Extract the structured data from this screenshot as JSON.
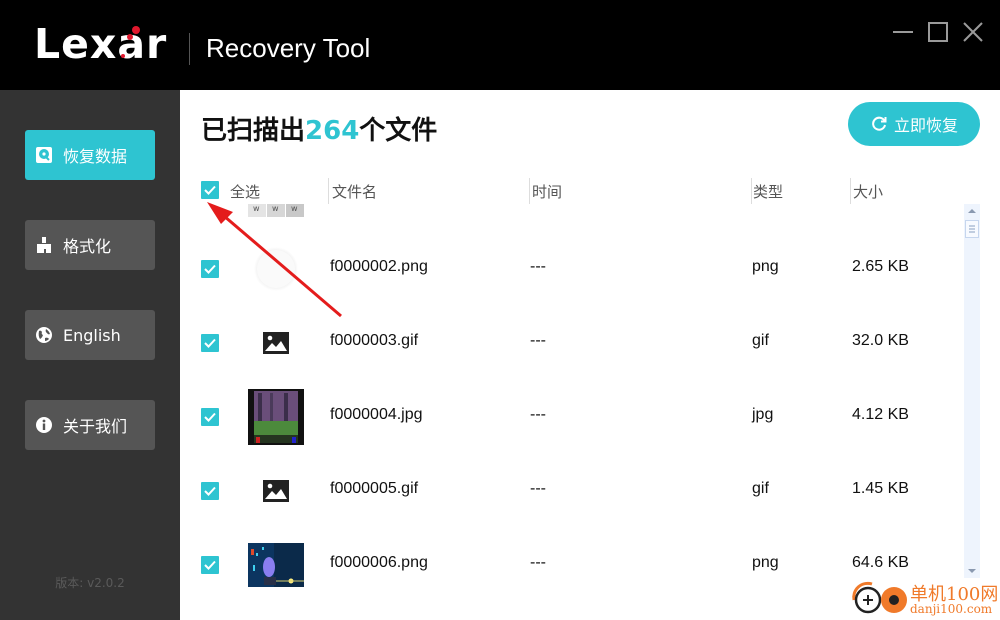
{
  "window": {
    "brand": "Lexar",
    "title": "Recovery Tool",
    "controls": [
      "minimize-icon",
      "maximize-icon",
      "close-icon"
    ]
  },
  "sidebar": {
    "items": [
      {
        "label": "恢复数据",
        "icon": "disk-recover-icon",
        "active": true
      },
      {
        "label": "格式化",
        "icon": "broom-icon",
        "active": false
      },
      {
        "label": "English",
        "icon": "globe-icon",
        "active": false
      },
      {
        "label": "关于我们",
        "icon": "info-icon",
        "active": false
      }
    ],
    "version": "版本: v2.0.2"
  },
  "main": {
    "title_prefix": "已扫描出",
    "file_count": "264",
    "title_suffix": "个文件",
    "recover_button": "立即恢复",
    "accent_color": "#2ec4d1"
  },
  "table": {
    "select_all_label": "全选",
    "select_all_checked": true,
    "columns": [
      "文件名",
      "时间",
      "类型",
      "大小"
    ],
    "rows": [
      {
        "checked": true,
        "thumb": "partial-thumbnail",
        "name": "",
        "time": "",
        "type": "",
        "size": ""
      },
      {
        "checked": true,
        "thumb": "white-circle-thumbnail",
        "name": "f0000002.png",
        "time": "---",
        "type": "png",
        "size": "2.65 KB"
      },
      {
        "checked": true,
        "thumb": "image-placeholder-icon",
        "name": "f0000003.gif",
        "time": "---",
        "type": "gif",
        "size": "32.0 KB"
      },
      {
        "checked": true,
        "thumb": "game-screenshot-thumbnail",
        "name": "f0000004.jpg",
        "time": "---",
        "type": "jpg",
        "size": "4.12 KB"
      },
      {
        "checked": true,
        "thumb": "image-placeholder-icon",
        "name": "f0000005.gif",
        "time": "---",
        "type": "gif",
        "size": "1.45 KB"
      },
      {
        "checked": true,
        "thumb": "neon-city-thumbnail",
        "name": "f0000006.png",
        "time": "---",
        "type": "png",
        "size": "64.6 KB"
      }
    ]
  },
  "watermark": {
    "line1": "单机100网",
    "line2": "danji100.com"
  }
}
